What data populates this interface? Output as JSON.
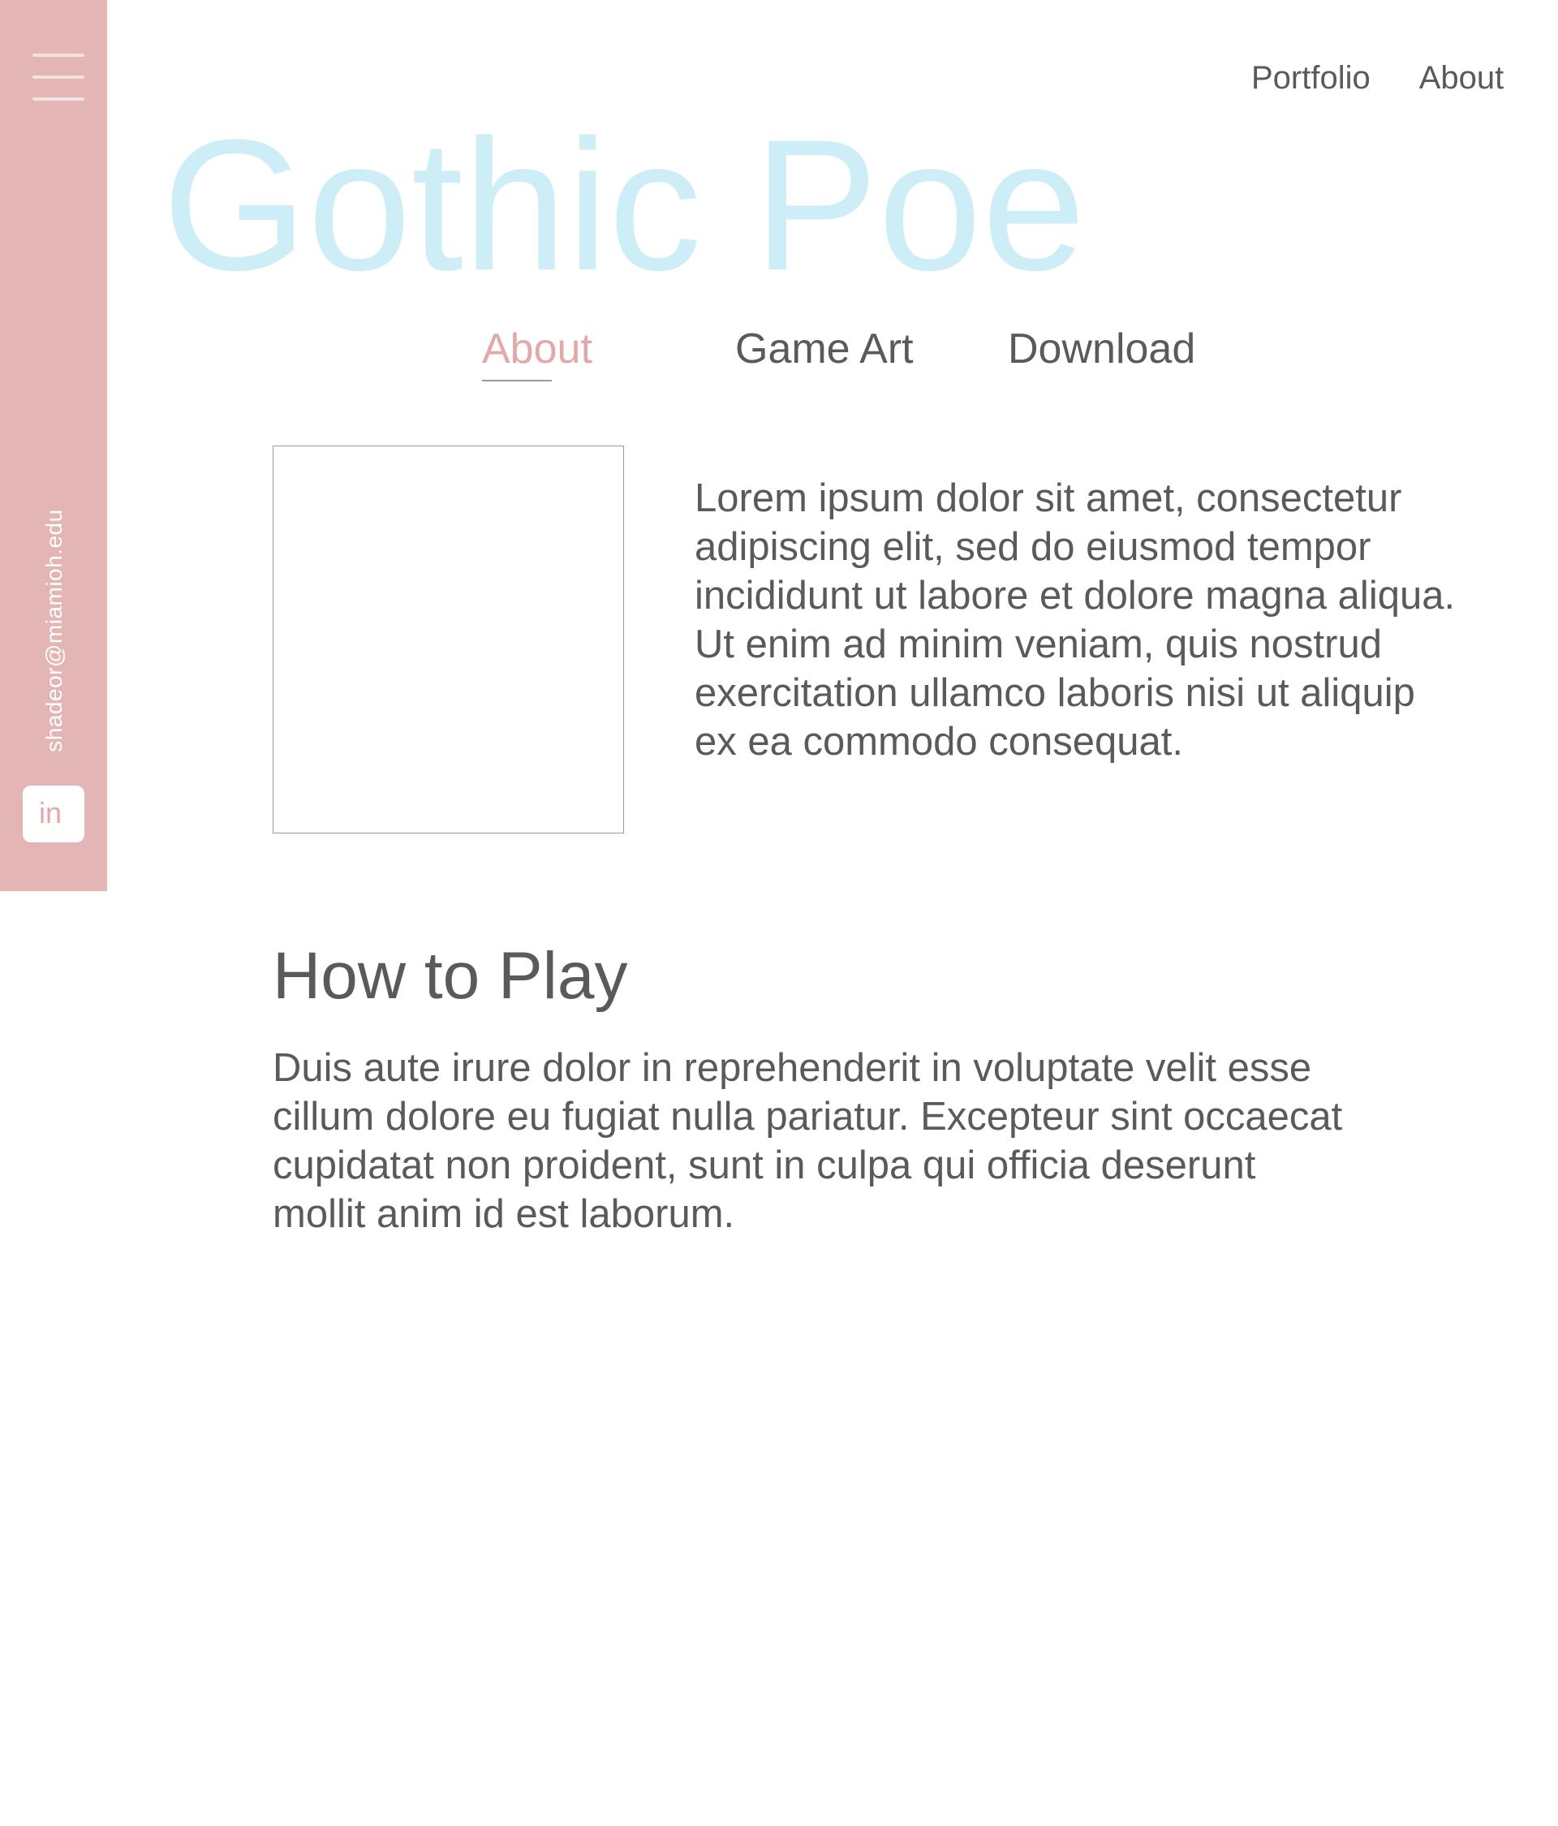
{
  "sidebar": {
    "menu_icon": "hamburger-menu-icon",
    "email": "shadeor@miamioh.edu",
    "linkedin_label": "in",
    "linkedin_icon": "linkedin-icon",
    "background_color": "#e3b5b5"
  },
  "top_nav": {
    "items": [
      {
        "label": "Portfolio"
      },
      {
        "label": "About"
      }
    ]
  },
  "title": "Gothic Poe",
  "tabs": [
    {
      "label": "About",
      "active": true
    },
    {
      "label": "Game Art",
      "active": false
    },
    {
      "label": "Download",
      "active": false
    }
  ],
  "intro": {
    "lines": [
      "Lorem ipsum dolor sit amet, consectetur",
      "adipiscing elit, sed do eiusmod tempor",
      "incididunt ut labore et dolore magna aliqua.",
      "Ut enim ad minim veniam, quis nostrud",
      "exercitation ullamco laboris nisi ut aliquip",
      "ex ea commodo consequat."
    ]
  },
  "how_to_play": {
    "heading": "How to Play",
    "lines": [
      "Duis aute irure dolor in reprehenderit in voluptate velit esse",
      "cillum dolore eu fugiat nulla pariatur. Excepteur sint occaecat",
      "cupidatat non proident, sunt in culpa qui officia deserunt",
      "mollit anim id est laborum."
    ]
  },
  "colors": {
    "accent_pink": "#e3a8a8",
    "title_cyan": "#cdeef6",
    "text_gray": "#5a5a5a"
  }
}
